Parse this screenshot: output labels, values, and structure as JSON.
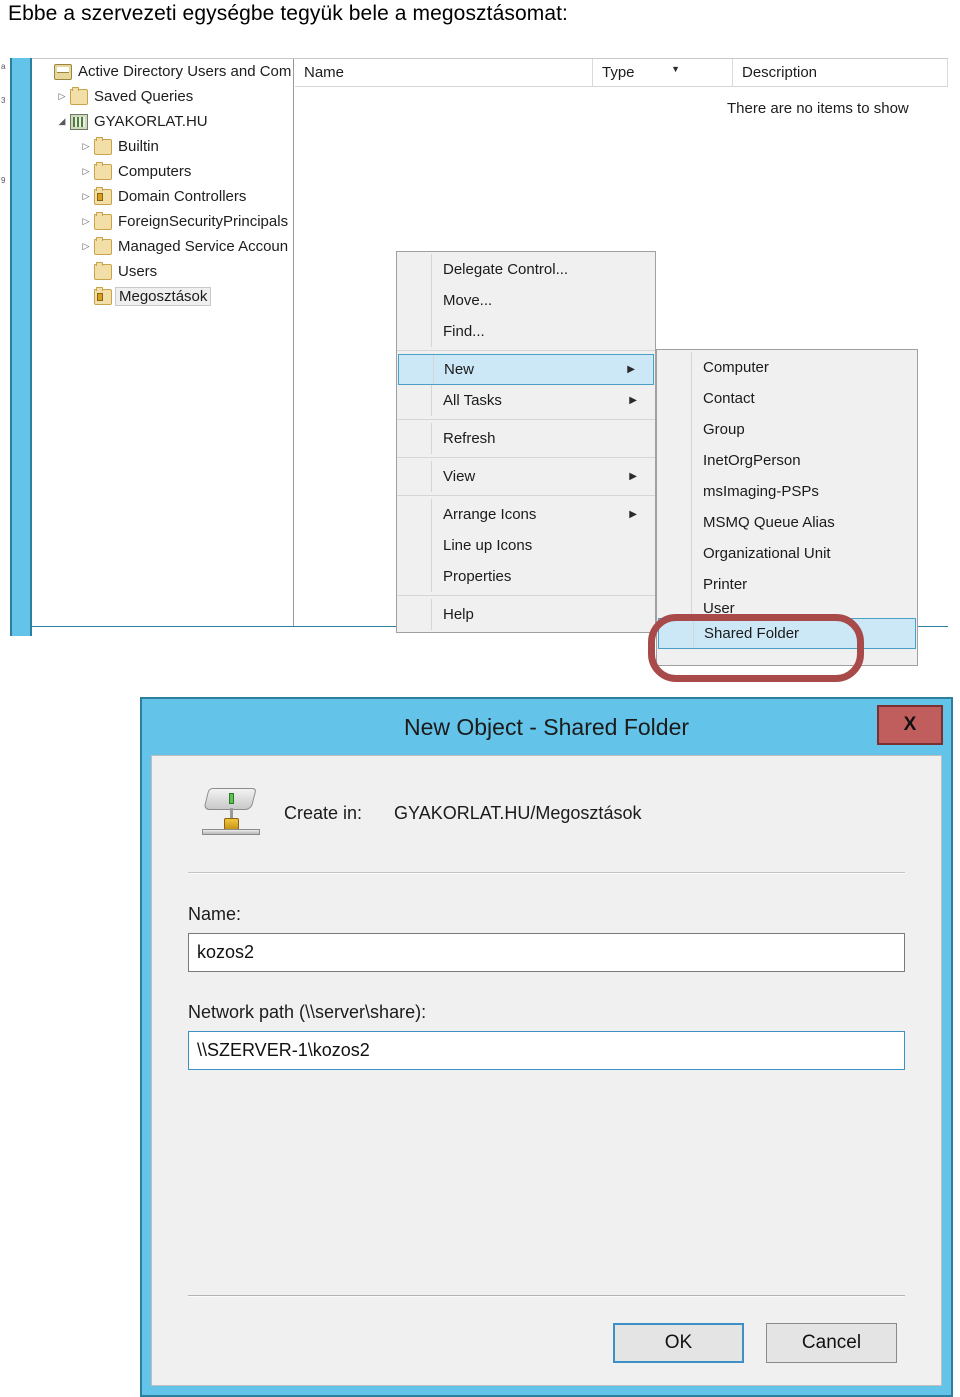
{
  "caption": "Ebbe a szervezeti egységbe tegyük bele a megosztásomat:",
  "colors": {
    "window_accent": "#64c3e8",
    "window_border": "#2d7fa0",
    "close_button": "#c05e5e",
    "menu_highlight": "#cce8f7",
    "menu_highlight_border": "#4a9fc4",
    "annotation_red": "#a84a4a",
    "folder_icon": "#f2dfa8"
  },
  "edge_fragments": [
    "a",
    "3",
    "9"
  ],
  "tree": {
    "nodes": [
      {
        "label": "Active Directory Users and Com",
        "twisty": "",
        "icon": "console-root-icon",
        "indent": 0,
        "selected": false
      },
      {
        "label": "Saved Queries",
        "twisty": "▷",
        "icon": "folder-icon",
        "indent": 1,
        "selected": false
      },
      {
        "label": "GYAKORLAT.HU",
        "twisty": "◢",
        "icon": "domain-icon",
        "indent": 1,
        "selected": false
      },
      {
        "label": "Builtin",
        "twisty": "▷",
        "icon": "folder-icon",
        "indent": 2,
        "selected": false
      },
      {
        "label": "Computers",
        "twisty": "▷",
        "icon": "folder-icon",
        "indent": 2,
        "selected": false
      },
      {
        "label": "Domain Controllers",
        "twisty": "▷",
        "icon": "ou-folder-icon",
        "indent": 2,
        "selected": false
      },
      {
        "label": "ForeignSecurityPrincipals",
        "twisty": "▷",
        "icon": "folder-icon",
        "indent": 2,
        "selected": false
      },
      {
        "label": "Managed Service Accoun",
        "twisty": "▷",
        "icon": "folder-icon",
        "indent": 2,
        "selected": false
      },
      {
        "label": "Users",
        "twisty": "",
        "icon": "folder-icon",
        "indent": 2,
        "selected": false
      },
      {
        "label": "Megosztások",
        "twisty": "",
        "icon": "ou-folder-icon",
        "indent": 2,
        "selected": true
      }
    ]
  },
  "list": {
    "columns": [
      "Name",
      "Type",
      "Description"
    ],
    "sort_indicator": "▼",
    "empty_message": "There are no items to show"
  },
  "context_menu": {
    "items": [
      {
        "label": "Delegate Control...",
        "submenu": false,
        "highlight": false
      },
      {
        "label": "Move...",
        "submenu": false,
        "highlight": false
      },
      {
        "label": "Find...",
        "submenu": false,
        "highlight": false
      },
      {
        "label": "New",
        "submenu": true,
        "highlight": true
      },
      {
        "label": "All Tasks",
        "submenu": true,
        "highlight": false
      },
      {
        "label": "Refresh",
        "submenu": false,
        "highlight": false
      },
      {
        "label": "View",
        "submenu": true,
        "highlight": false
      },
      {
        "label": "Arrange Icons",
        "submenu": true,
        "highlight": false
      },
      {
        "label": "Line up Icons",
        "submenu": false,
        "highlight": false
      },
      {
        "label": "Properties",
        "submenu": false,
        "highlight": false
      },
      {
        "label": "Help",
        "submenu": false,
        "highlight": false
      }
    ]
  },
  "new_submenu": {
    "items": [
      {
        "label": "Computer",
        "highlight": false,
        "clipped": false
      },
      {
        "label": "Contact",
        "highlight": false,
        "clipped": false
      },
      {
        "label": "Group",
        "highlight": false,
        "clipped": false
      },
      {
        "label": "InetOrgPerson",
        "highlight": false,
        "clipped": false
      },
      {
        "label": "msImaging-PSPs",
        "highlight": false,
        "clipped": false
      },
      {
        "label": "MSMQ Queue Alias",
        "highlight": false,
        "clipped": false
      },
      {
        "label": "Organizational Unit",
        "highlight": false,
        "clipped": false
      },
      {
        "label": "Printer",
        "highlight": false,
        "clipped": false
      },
      {
        "label": "User",
        "highlight": false,
        "clipped": true
      },
      {
        "label": "Shared Folder",
        "highlight": true,
        "clipped": false
      }
    ]
  },
  "dialog": {
    "title": "New Object - Shared Folder",
    "close_label": "X",
    "create_in_label": "Create in:",
    "create_in_value": "GYAKORLAT.HU/Megosztások",
    "name_label": "Name:",
    "name_value": "kozos2",
    "path_label": "Network path (\\\\server\\share):",
    "path_value": "\\\\SZERVER-1\\kozos2",
    "ok_label": "OK",
    "cancel_label": "Cancel"
  }
}
